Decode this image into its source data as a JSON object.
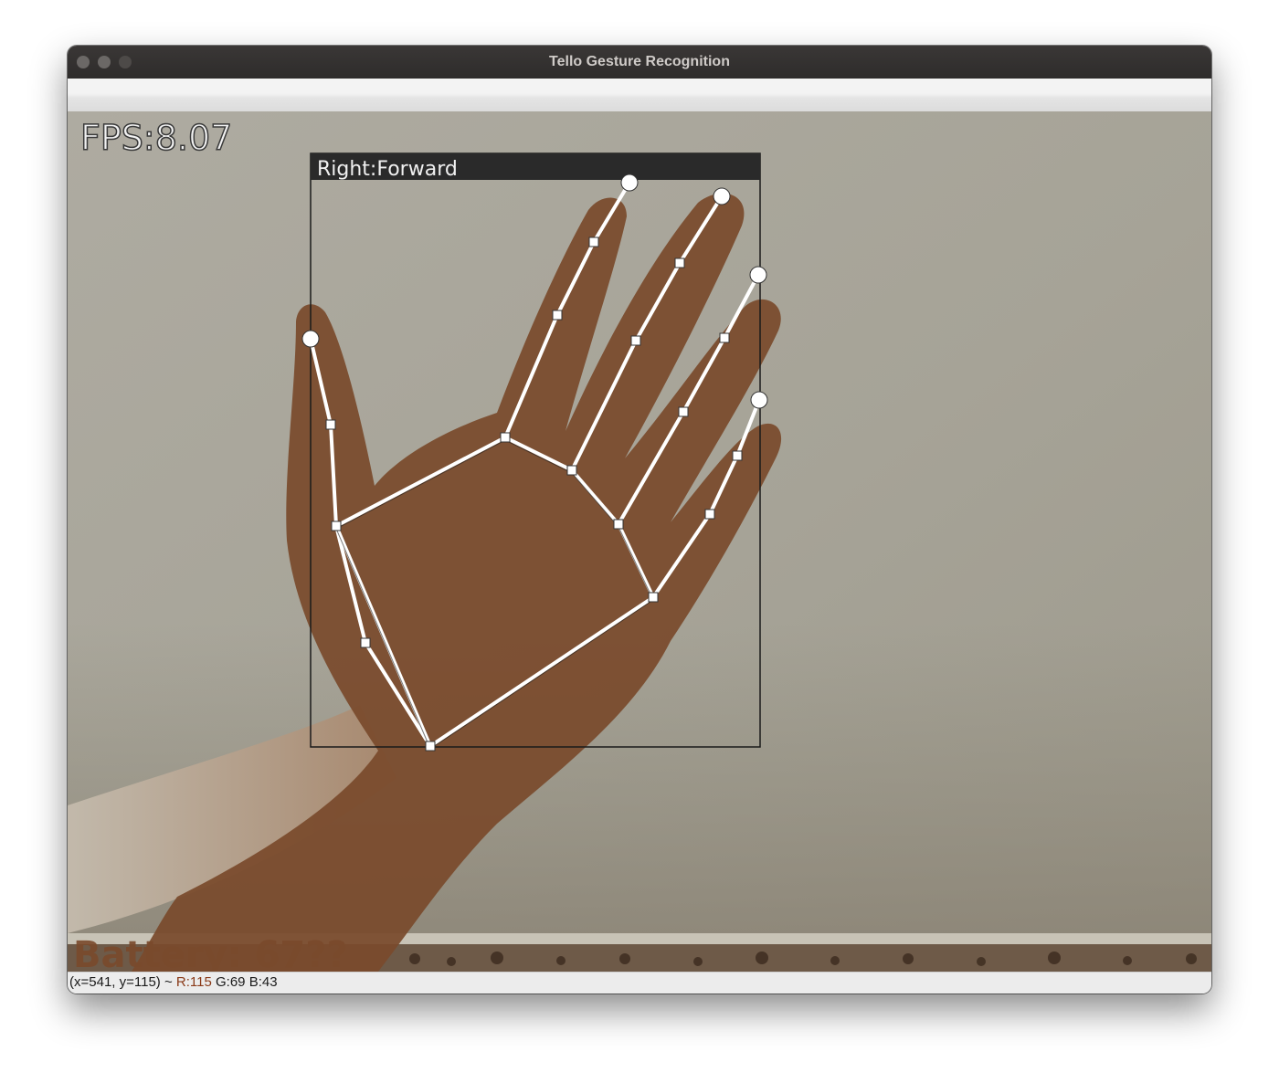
{
  "window": {
    "title": "Tello Gesture Recognition"
  },
  "overlay": {
    "fps_text": "FPS:8.07",
    "hand_label": "Right:Forward",
    "battery_text": "Battery: 67??"
  },
  "status": {
    "coords": "(x=541, y=115) ~",
    "r_label": "R:115",
    "g_label": "G:69",
    "b_label": "B:43"
  },
  "colors": {
    "hand_mask": "#7a4a2c",
    "skeleton": "#ffffff",
    "label_bar": "#2a2a2a"
  }
}
